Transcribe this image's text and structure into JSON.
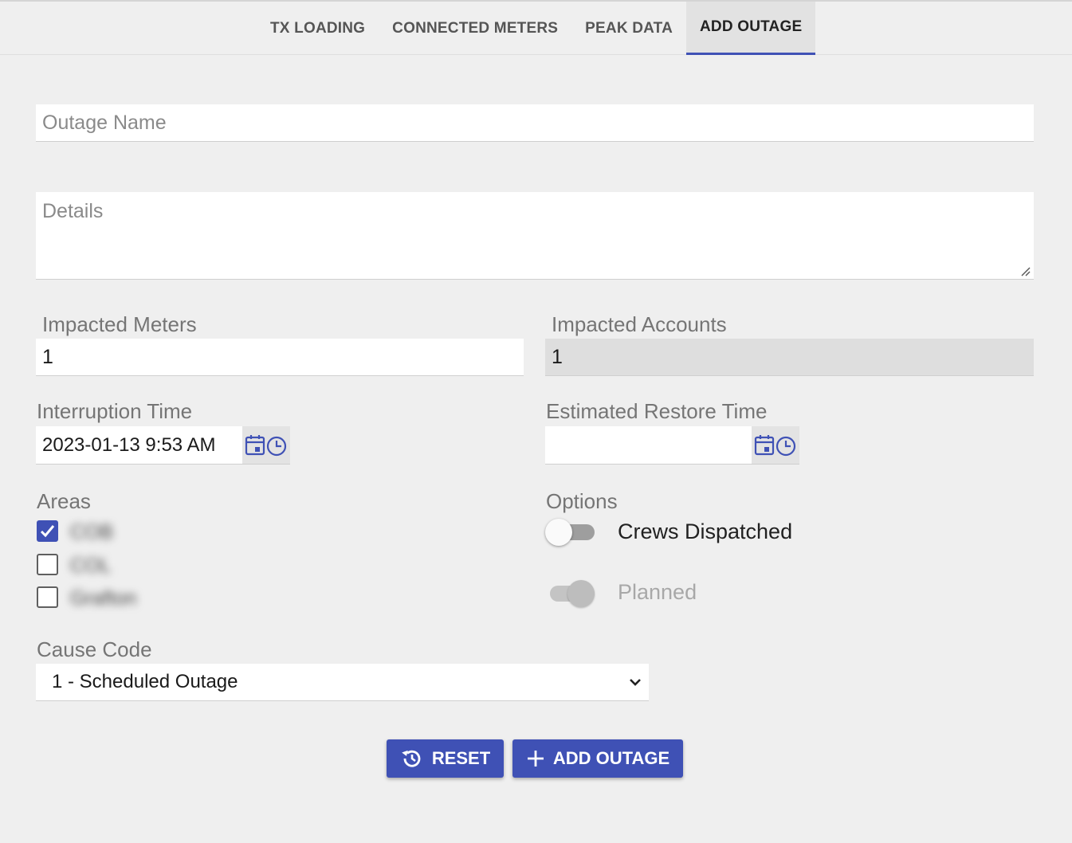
{
  "tabs": [
    {
      "label": "TX LOADING",
      "active": false
    },
    {
      "label": "CONNECTED METERS",
      "active": false
    },
    {
      "label": "PEAK DATA",
      "active": false
    },
    {
      "label": "ADD OUTAGE",
      "active": true
    }
  ],
  "form": {
    "outage_name": {
      "placeholder": "Outage Name",
      "value": ""
    },
    "details": {
      "placeholder": "Details",
      "value": ""
    },
    "impacted_meters": {
      "label": "Impacted Meters",
      "value": "1"
    },
    "impacted_accounts": {
      "label": "Impacted Accounts",
      "value": "1"
    },
    "interruption_time": {
      "label": "Interruption Time",
      "value": "2023-01-13 9:53 AM"
    },
    "estimated_restore_time": {
      "label": "Estimated Restore Time",
      "value": ""
    },
    "areas": {
      "label": "Areas",
      "items": [
        {
          "label": "COB",
          "checked": true
        },
        {
          "label": "COL",
          "checked": false
        },
        {
          "label": "Grafton",
          "checked": false
        }
      ]
    },
    "options": {
      "label": "Options",
      "crews_dispatched": {
        "label": "Crews Dispatched",
        "on": false
      },
      "planned": {
        "label": "Planned",
        "on": true,
        "disabled": true
      }
    },
    "cause_code": {
      "label": "Cause Code",
      "selected": "1 - Scheduled Outage"
    }
  },
  "buttons": {
    "reset": "RESET",
    "add_outage": "ADD OUTAGE"
  },
  "colors": {
    "accent": "#3f51b5",
    "background": "#efefef"
  }
}
